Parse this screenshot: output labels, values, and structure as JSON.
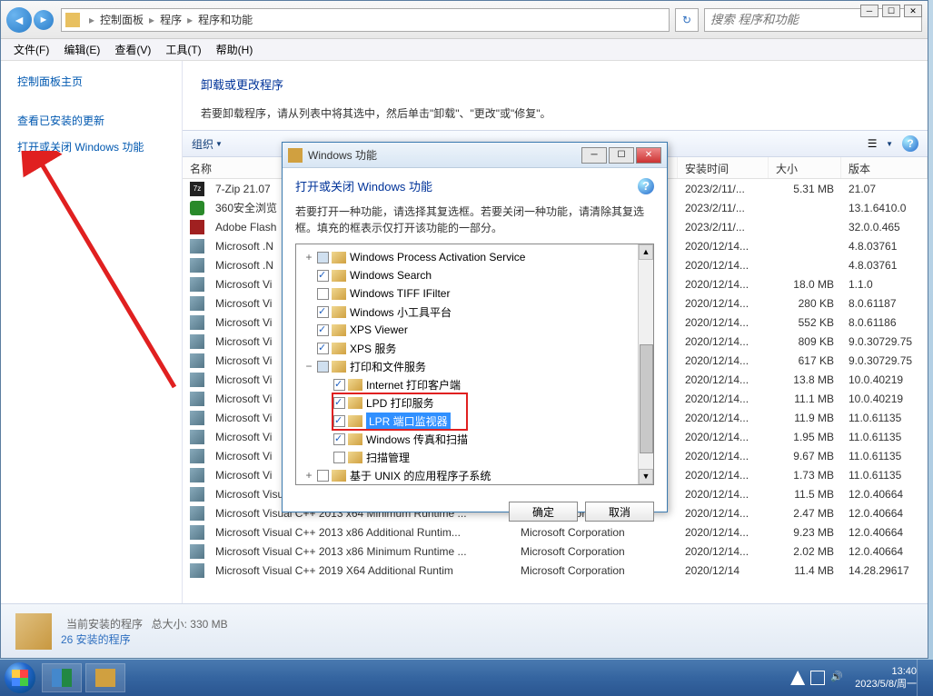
{
  "window": {
    "breadcrumb": [
      "控制面板",
      "程序",
      "程序和功能"
    ],
    "search_placeholder": "搜索 程序和功能"
  },
  "menus": [
    "文件(F)",
    "编辑(E)",
    "查看(V)",
    "工具(T)",
    "帮助(H)"
  ],
  "sidebar": {
    "title": "控制面板主页",
    "links": [
      "查看已安装的更新",
      "打开或关闭 Windows 功能"
    ]
  },
  "content": {
    "heading": "卸载或更改程序",
    "desc": "若要卸载程序，请从列表中将其选中，然后单击\"卸载\"、\"更改\"或\"修复\"。",
    "organize": "组织"
  },
  "columns": {
    "name": "名称",
    "publisher": "",
    "date": "安装时间",
    "size": "大小",
    "version": "版本"
  },
  "programs": [
    {
      "icon": "7z",
      "name": "7-Zip 21.07",
      "date": "2023/2/11/...",
      "size": "5.31 MB",
      "ver": "21.07"
    },
    {
      "icon": "360",
      "name": "360安全浏览",
      "date": "2023/2/11/...",
      "size": "",
      "ver": "13.1.6410.0"
    },
    {
      "icon": "flash",
      "name": "Adobe Flash",
      "date": "2023/2/11/...",
      "size": "",
      "ver": "32.0.0.465"
    },
    {
      "icon": "ms",
      "name": "Microsoft .N",
      "date": "2020/12/14...",
      "size": "",
      "ver": "4.8.03761"
    },
    {
      "icon": "ms",
      "name": "Microsoft .N",
      "date": "2020/12/14...",
      "size": "",
      "ver": "4.8.03761"
    },
    {
      "icon": "ms",
      "name": "Microsoft Vi",
      "date": "2020/12/14...",
      "size": "18.0 MB",
      "ver": "1.1.0"
    },
    {
      "icon": "ms",
      "name": "Microsoft Vi",
      "date": "2020/12/14...",
      "size": "280 KB",
      "ver": "8.0.61187"
    },
    {
      "icon": "ms",
      "name": "Microsoft Vi",
      "date": "2020/12/14...",
      "size": "552 KB",
      "ver": "8.0.61186"
    },
    {
      "icon": "ms",
      "name": "Microsoft Vi",
      "date": "2020/12/14...",
      "size": "809 KB",
      "ver": "9.0.30729.75"
    },
    {
      "icon": "ms",
      "name": "Microsoft Vi",
      "date": "2020/12/14...",
      "size": "617 KB",
      "ver": "9.0.30729.75"
    },
    {
      "icon": "ms",
      "name": "Microsoft Vi",
      "date": "2020/12/14...",
      "size": "13.8 MB",
      "ver": "10.0.40219"
    },
    {
      "icon": "ms",
      "name": "Microsoft Vi",
      "date": "2020/12/14...",
      "size": "11.1 MB",
      "ver": "10.0.40219"
    },
    {
      "icon": "ms",
      "name": "Microsoft Vi",
      "date": "2020/12/14...",
      "size": "11.9 MB",
      "ver": "11.0.61135"
    },
    {
      "icon": "ms",
      "name": "Microsoft Vi",
      "date": "2020/12/14...",
      "size": "1.95 MB",
      "ver": "11.0.61135"
    },
    {
      "icon": "ms",
      "name": "Microsoft Vi",
      "date": "2020/12/14...",
      "size": "9.67 MB",
      "ver": "11.0.61135"
    },
    {
      "icon": "ms",
      "name": "Microsoft Vi",
      "date": "2020/12/14...",
      "size": "1.73 MB",
      "ver": "11.0.61135"
    },
    {
      "icon": "ms",
      "name": "Microsoft Visual",
      "date": "2020/12/14...",
      "size": "11.5 MB",
      "ver": "12.0.40664"
    },
    {
      "icon": "ms",
      "name": "Microsoft Visual C++ 2013 x64 Minimum Runtime ...",
      "pub": "Microsoft Corporation",
      "date": "2020/12/14...",
      "size": "2.47 MB",
      "ver": "12.0.40664"
    },
    {
      "icon": "ms",
      "name": "Microsoft Visual C++ 2013 x86 Additional Runtim...",
      "pub": "Microsoft Corporation",
      "date": "2020/12/14...",
      "size": "9.23 MB",
      "ver": "12.0.40664"
    },
    {
      "icon": "ms",
      "name": "Microsoft Visual C++ 2013 x86 Minimum Runtime ...",
      "pub": "Microsoft Corporation",
      "date": "2020/12/14...",
      "size": "2.02 MB",
      "ver": "12.0.40664"
    },
    {
      "icon": "ms",
      "name": "Microsoft Visual C++ 2019 X64 Additional Runtim",
      "pub": "Microsoft Corporation",
      "date": "2020/12/14",
      "size": "11.4 MB",
      "ver": "14.28.29617"
    }
  ],
  "footer": {
    "title": "当前安装的程序",
    "total": "总大小: 330 MB",
    "count": "26 安装的程序"
  },
  "dialog": {
    "title": "Windows 功能",
    "heading": "打开或关闭 Windows 功能",
    "desc": "若要打开一种功能，请选择其复选框。若要关闭一种功能，请清除其复选框。填充的框表示仅打开该功能的一部分。",
    "tree": [
      {
        "lvl": 1,
        "exp": "+",
        "chk": "blue",
        "label": "Windows Process Activation Service"
      },
      {
        "lvl": 1,
        "exp": "",
        "chk": "checked",
        "label": "Windows Search"
      },
      {
        "lvl": 1,
        "exp": "",
        "chk": "",
        "label": "Windows TIFF IFilter"
      },
      {
        "lvl": 1,
        "exp": "",
        "chk": "checked",
        "label": "Windows 小工具平台"
      },
      {
        "lvl": 1,
        "exp": "",
        "chk": "checked",
        "label": "XPS Viewer"
      },
      {
        "lvl": 1,
        "exp": "",
        "chk": "checked",
        "label": "XPS 服务"
      },
      {
        "lvl": 1,
        "exp": "−",
        "chk": "blue",
        "label": "打印和文件服务"
      },
      {
        "lvl": 2,
        "exp": "",
        "chk": "checked",
        "label": "Internet 打印客户端"
      },
      {
        "lvl": 2,
        "exp": "",
        "chk": "checked",
        "label": "LPD 打印服务",
        "boxed": true
      },
      {
        "lvl": 2,
        "exp": "",
        "chk": "checked",
        "label": "LPR 端口监视器",
        "boxed": true,
        "selected": true
      },
      {
        "lvl": 2,
        "exp": "",
        "chk": "checked",
        "label": "Windows 传真和扫描"
      },
      {
        "lvl": 2,
        "exp": "",
        "chk": "",
        "label": "扫描管理"
      },
      {
        "lvl": 1,
        "exp": "+",
        "chk": "",
        "label": "基于 UNIX 的应用程序子系统"
      }
    ],
    "ok": "确定",
    "cancel": "取消"
  },
  "tray": {
    "time": "13:40",
    "date": "2023/5/8/周一"
  }
}
